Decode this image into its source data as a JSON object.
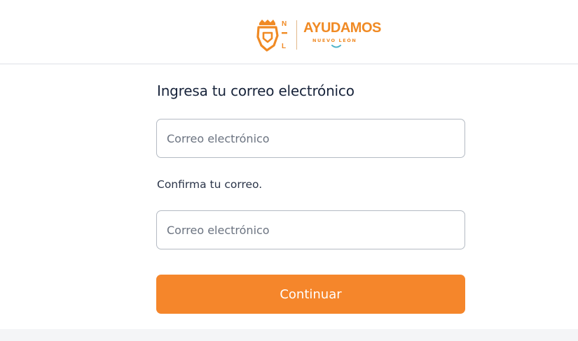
{
  "brand": {
    "logo_main": "AYUDAMOS",
    "logo_sub": "NUEVO LEÓN",
    "logo_letters": [
      "N",
      "L"
    ],
    "accent_color": "#f5862b"
  },
  "form": {
    "title": "Ingresa tu correo electrónico",
    "email_placeholder": "Correo electrónico",
    "confirm_label": "Confirma tu correo.",
    "confirm_placeholder": "Correo electrónico",
    "submit_label": "Continuar"
  }
}
